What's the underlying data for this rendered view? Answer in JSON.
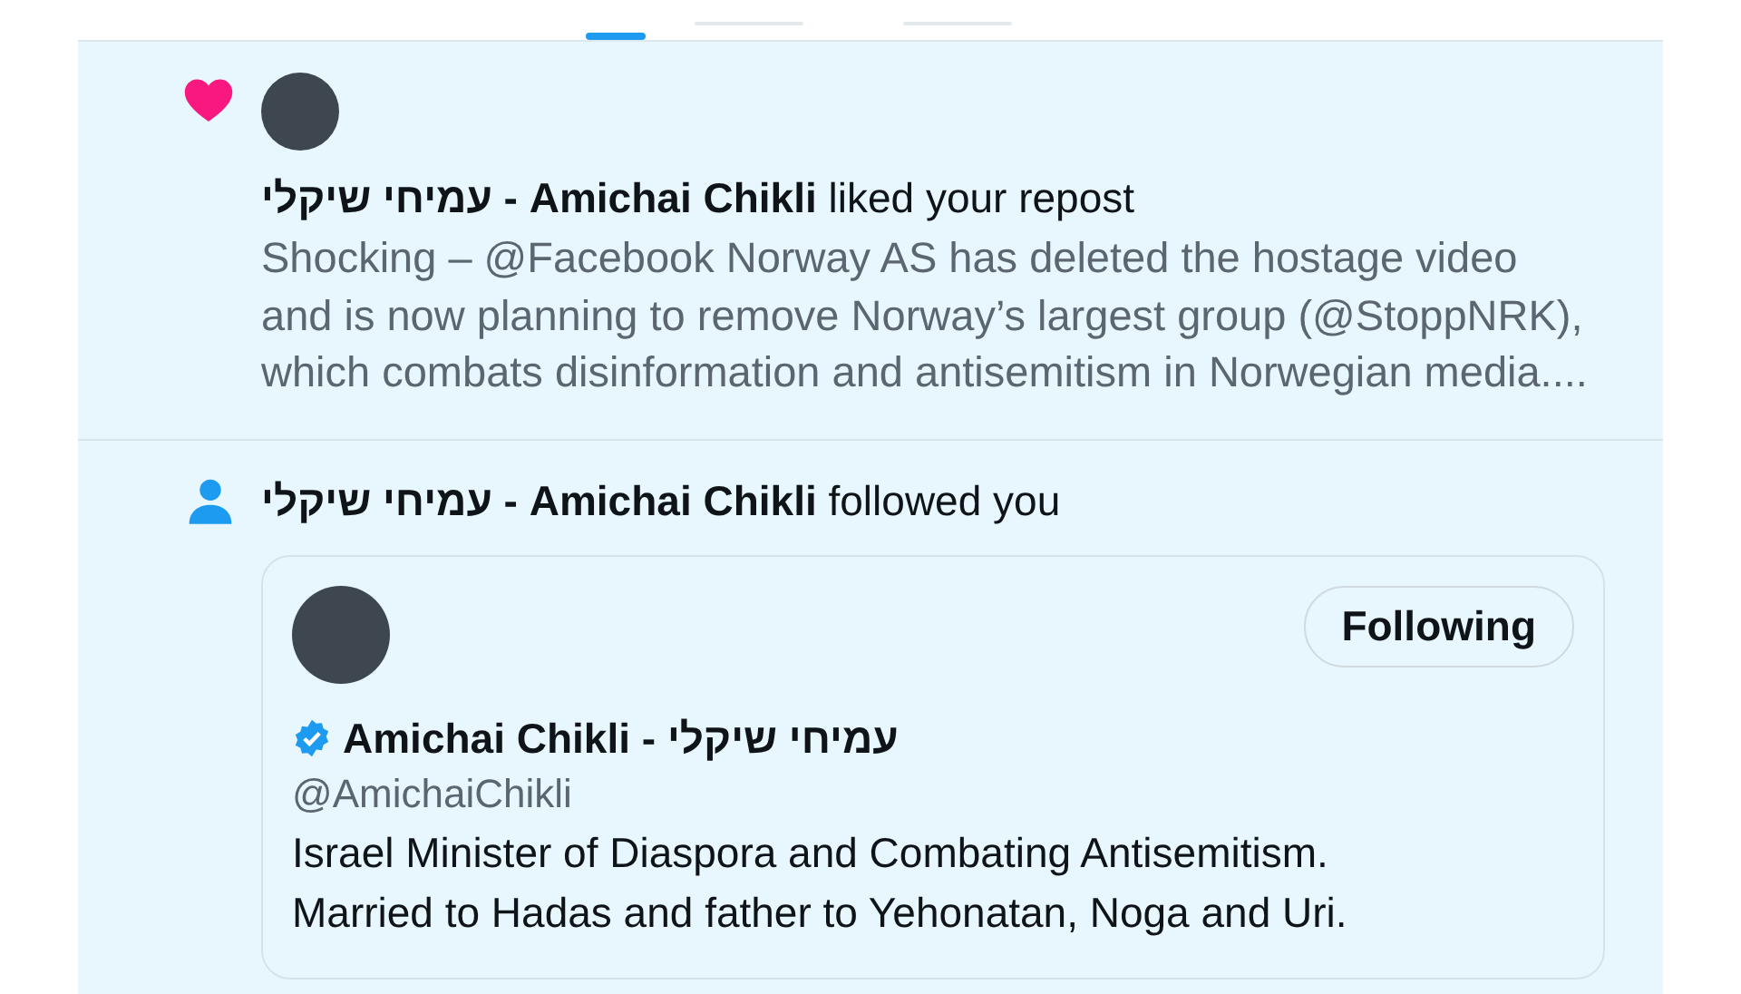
{
  "tabs": [
    {
      "selected": true
    },
    {
      "selected": false
    },
    {
      "selected": false
    }
  ],
  "notifications": [
    {
      "kind": "like",
      "actor": "עמיחי שיקלי - Amichai Chikli",
      "action": "liked your repost",
      "text": "Shocking – @Facebook Norway AS has deleted the hostage video and is now planning to remove Norway’s largest group (@StoppNRK), which combats disinformation and antisemitism in Norwegian media...."
    },
    {
      "kind": "follow",
      "actor": "עמיחי שיקלי - Amichai Chikli",
      "action": "followed you",
      "profile": {
        "name": "Amichai Chikli - עמיחי שיקלי",
        "verified": true,
        "handle": "@AmichaiChikli",
        "button": "Following",
        "bio": [
          "Israel Minister of Diaspora and Combating Antisemitism.",
          "Married to Hadas and father to Yehonatan, Noga and Uri."
        ]
      }
    }
  ]
}
